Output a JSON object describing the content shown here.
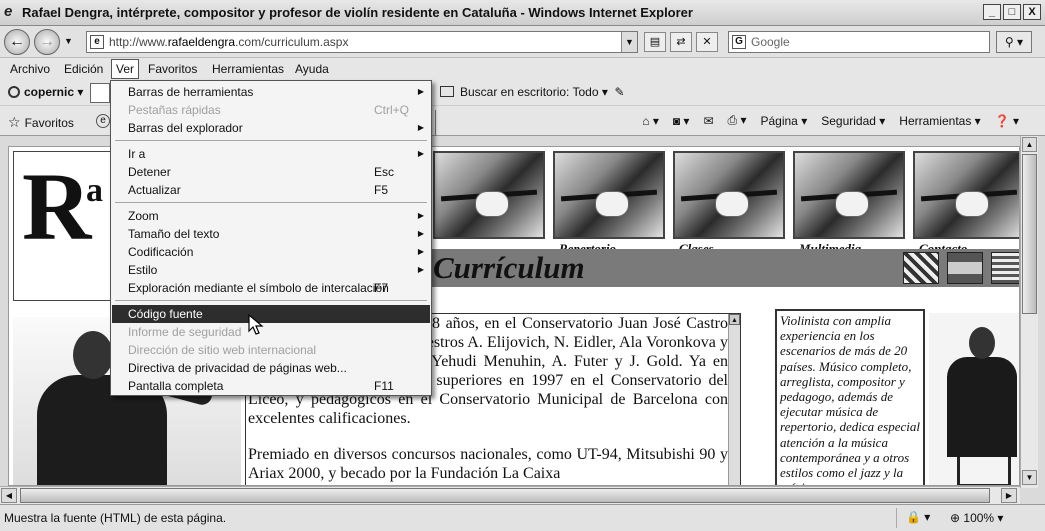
{
  "window": {
    "title": "Rafael Dengra, intérprete, compositor y profesor de violín residente en Cataluña - Windows Internet Explorer",
    "minimize": "_",
    "maximize": "□",
    "close": "X"
  },
  "address": {
    "url_prefix": "http://www.",
    "url_domain": "rafaeldengra",
    "url_suffix": ".com/curriculum.aspx",
    "search_placeholder": "Google"
  },
  "menubar": {
    "items": [
      "Archivo",
      "Edición",
      "Ver",
      "Favoritos",
      "Herramientas",
      "Ayuda"
    ],
    "active": "Ver"
  },
  "links_toolbar": {
    "copernic": "copernic",
    "buscar": "Buscar en escritorio: Todo"
  },
  "favorites_bar": {
    "favoritos": "Favoritos",
    "commands": [
      "Página",
      "Seguridad",
      "Herramientas"
    ]
  },
  "view_menu": {
    "items": [
      {
        "label": "Barras de herramientas",
        "shortcut": "",
        "submenu": true,
        "disabled": false
      },
      {
        "label": "Pestañas rápidas",
        "shortcut": "Ctrl+Q",
        "submenu": false,
        "disabled": true
      },
      {
        "label": "Barras del explorador",
        "shortcut": "",
        "submenu": true,
        "disabled": false
      },
      {
        "label": "Ir a",
        "shortcut": "",
        "submenu": true,
        "disabled": false
      },
      {
        "label": "Detener",
        "shortcut": "Esc",
        "submenu": false,
        "disabled": false
      },
      {
        "label": "Actualizar",
        "shortcut": "F5",
        "submenu": false,
        "disabled": false
      },
      {
        "label": "Zoom",
        "shortcut": "",
        "submenu": true,
        "disabled": false
      },
      {
        "label": "Tamaño del texto",
        "shortcut": "",
        "submenu": true,
        "disabled": false
      },
      {
        "label": "Codificación",
        "shortcut": "",
        "submenu": true,
        "disabled": false
      },
      {
        "label": "Estilo",
        "shortcut": "",
        "submenu": true,
        "disabled": false
      },
      {
        "label": "Exploración mediante el símbolo de intercalación",
        "shortcut": "F7",
        "submenu": false,
        "disabled": false
      },
      {
        "label": "Código fuente",
        "shortcut": "",
        "submenu": false,
        "disabled": false,
        "highlighted": true
      },
      {
        "label": "Informe de seguridad",
        "shortcut": "",
        "submenu": false,
        "disabled": true
      },
      {
        "label": "Dirección de sitio web internacional",
        "shortcut": "",
        "submenu": false,
        "disabled": true
      },
      {
        "label": "Directiva de privacidad de páginas web...",
        "shortcut": "",
        "submenu": false,
        "disabled": false
      },
      {
        "label": "Pantalla completa",
        "shortcut": "F11",
        "submenu": false,
        "disabled": false
      }
    ]
  },
  "site": {
    "logo_big": "R",
    "logo_small": "a",
    "nav": [
      "Repertorio",
      "Clases",
      "Multimedia",
      "Contacto"
    ],
    "banner_title": "Currículum",
    "paragraph1": "comenzó sus estudios a los 8 años, en el Conservatorio Juan José Castro de Buenos Aires con los maestros A. Elijovich, N. Eidler, Ala Voronkova y J. Gold. Recibió clases de Yehudi Menuhin, A. Futer y J. Gold. Ya en España, acabó sus estudios superiores en 1997 en el Conservatorio del Liceo, y pedagógicos en el Conservatorio Municipal de Barcelona con excelentes calificaciones.",
    "paragraph2": "Premiado en diversos concursos nacionales, como UT-94, Mitsubishi 90 y Ariax 2000, y becado por la Fundación La Caixa",
    "side_text": "Violinista con amplia experiencia en los escenarios de más de 20 países. Músico completo, arreglista, compositor y pedagogo, además de ejecutar música de repertorio, dedica especial atención a la música contemporánea y a otros estilos como el jazz y la música"
  },
  "status": {
    "text": "Muestra la fuente (HTML) de esta página.",
    "zoom": "100%"
  }
}
